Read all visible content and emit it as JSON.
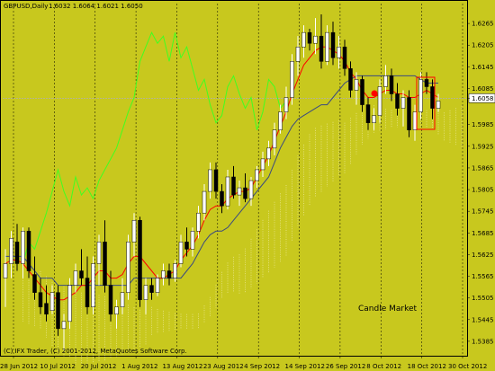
{
  "window": {
    "title": "GBPUSD,Daily",
    "ohlc": "1.6032 1.6064 1.6021 1.6050",
    "copyright": "(C) IFX Trader, (C) 2001-2012, MetaQuotes Software Corp.",
    "watermark": "Candle Market"
  },
  "colors": {
    "background": "#c8c81e",
    "bull_candle": "#ffffff",
    "bear_candle": "#000000",
    "tenkan": "#ff0000",
    "kijun": "#3a4a80",
    "chikou": "#40ff20",
    "cloud_a": "#f5f0b4",
    "cloud_b": "#e8b070",
    "price_line": "#b0b0b0"
  },
  "chart_data": {
    "type": "candlestick",
    "symbol": "GBPUSD",
    "timeframe": "Daily",
    "last_price": 1.6058,
    "ylim": [
      1.535,
      1.632
    ],
    "y_ticks": [
      "1.6265",
      "1.6205",
      "1.6145",
      "1.6085",
      "1.6058",
      "1.5985",
      "1.5925",
      "1.5865",
      "1.5805",
      "1.5745",
      "1.5685",
      "1.5625",
      "1.5565",
      "1.5505",
      "1.5445",
      "1.5385"
    ],
    "x_ticks": [
      "28 Jun 2012",
      "10 Jul 2012",
      "20 Jul 2012",
      "1 Aug 2012",
      "13 Aug 2012",
      "23 Aug 2012",
      "4 Sep 2012",
      "14 Sep 2012",
      "26 Sep 2012",
      "8 Oct 2012",
      "18 Oct 2012",
      "30 Oct 2012"
    ],
    "grid": "vertical dotted separators",
    "candles": [
      {
        "o": 1.556,
        "h": 1.564,
        "l": 1.548,
        "c": 1.56
      },
      {
        "o": 1.56,
        "h": 1.569,
        "l": 1.556,
        "c": 1.567
      },
      {
        "o": 1.566,
        "h": 1.571,
        "l": 1.558,
        "c": 1.56
      },
      {
        "o": 1.56,
        "h": 1.57,
        "l": 1.556,
        "c": 1.569
      },
      {
        "o": 1.569,
        "h": 1.57,
        "l": 1.556,
        "c": 1.558
      },
      {
        "o": 1.557,
        "h": 1.562,
        "l": 1.55,
        "c": 1.552
      },
      {
        "o": 1.552,
        "h": 1.556,
        "l": 1.546,
        "c": 1.548
      },
      {
        "o": 1.549,
        "h": 1.554,
        "l": 1.544,
        "c": 1.546
      },
      {
        "o": 1.547,
        "h": 1.554,
        "l": 1.546,
        "c": 1.552
      },
      {
        "o": 1.552,
        "h": 1.554,
        "l": 1.54,
        "c": 1.542
      },
      {
        "o": 1.542,
        "h": 1.546,
        "l": 1.536,
        "c": 1.544
      },
      {
        "o": 1.544,
        "h": 1.556,
        "l": 1.542,
        "c": 1.554
      },
      {
        "o": 1.554,
        "h": 1.56,
        "l": 1.552,
        "c": 1.558
      },
      {
        "o": 1.558,
        "h": 1.564,
        "l": 1.554,
        "c": 1.556
      },
      {
        "o": 1.556,
        "h": 1.562,
        "l": 1.546,
        "c": 1.548
      },
      {
        "o": 1.548,
        "h": 1.562,
        "l": 1.546,
        "c": 1.56
      },
      {
        "o": 1.56,
        "h": 1.568,
        "l": 1.554,
        "c": 1.566
      },
      {
        "o": 1.566,
        "h": 1.572,
        "l": 1.552,
        "c": 1.554
      },
      {
        "o": 1.554,
        "h": 1.558,
        "l": 1.544,
        "c": 1.546
      },
      {
        "o": 1.546,
        "h": 1.55,
        "l": 1.542,
        "c": 1.548
      },
      {
        "o": 1.548,
        "h": 1.556,
        "l": 1.546,
        "c": 1.552
      },
      {
        "o": 1.552,
        "h": 1.568,
        "l": 1.55,
        "c": 1.566
      },
      {
        "o": 1.566,
        "h": 1.574,
        "l": 1.562,
        "c": 1.572
      },
      {
        "o": 1.572,
        "h": 1.573,
        "l": 1.548,
        "c": 1.55
      },
      {
        "o": 1.55,
        "h": 1.556,
        "l": 1.546,
        "c": 1.554
      },
      {
        "o": 1.554,
        "h": 1.556,
        "l": 1.55,
        "c": 1.552
      },
      {
        "o": 1.552,
        "h": 1.557,
        "l": 1.551,
        "c": 1.556
      },
      {
        "o": 1.556,
        "h": 1.56,
        "l": 1.554,
        "c": 1.558
      },
      {
        "o": 1.558,
        "h": 1.56,
        "l": 1.554,
        "c": 1.556
      },
      {
        "o": 1.556,
        "h": 1.561,
        "l": 1.555,
        "c": 1.56
      },
      {
        "o": 1.56,
        "h": 1.568,
        "l": 1.559,
        "c": 1.566
      },
      {
        "o": 1.566,
        "h": 1.57,
        "l": 1.562,
        "c": 1.564
      },
      {
        "o": 1.564,
        "h": 1.57,
        "l": 1.562,
        "c": 1.569
      },
      {
        "o": 1.569,
        "h": 1.576,
        "l": 1.567,
        "c": 1.574
      },
      {
        "o": 1.574,
        "h": 1.582,
        "l": 1.572,
        "c": 1.58
      },
      {
        "o": 1.58,
        "h": 1.588,
        "l": 1.578,
        "c": 1.586
      },
      {
        "o": 1.586,
        "h": 1.588,
        "l": 1.578,
        "c": 1.58
      },
      {
        "o": 1.58,
        "h": 1.582,
        "l": 1.574,
        "c": 1.576
      },
      {
        "o": 1.576,
        "h": 1.586,
        "l": 1.575,
        "c": 1.584
      },
      {
        "o": 1.584,
        "h": 1.587,
        "l": 1.578,
        "c": 1.579
      },
      {
        "o": 1.579,
        "h": 1.583,
        "l": 1.576,
        "c": 1.581
      },
      {
        "o": 1.581,
        "h": 1.585,
        "l": 1.577,
        "c": 1.578
      },
      {
        "o": 1.578,
        "h": 1.584,
        "l": 1.576,
        "c": 1.583
      },
      {
        "o": 1.583,
        "h": 1.587,
        "l": 1.581,
        "c": 1.586
      },
      {
        "o": 1.586,
        "h": 1.591,
        "l": 1.584,
        "c": 1.589
      },
      {
        "o": 1.589,
        "h": 1.594,
        "l": 1.587,
        "c": 1.592
      },
      {
        "o": 1.592,
        "h": 1.599,
        "l": 1.59,
        "c": 1.597
      },
      {
        "o": 1.597,
        "h": 1.604,
        "l": 1.596,
        "c": 1.602
      },
      {
        "o": 1.602,
        "h": 1.609,
        "l": 1.6,
        "c": 1.606
      },
      {
        "o": 1.606,
        "h": 1.618,
        "l": 1.604,
        "c": 1.616
      },
      {
        "o": 1.616,
        "h": 1.623,
        "l": 1.612,
        "c": 1.62
      },
      {
        "o": 1.62,
        "h": 1.626,
        "l": 1.617,
        "c": 1.624
      },
      {
        "o": 1.624,
        "h": 1.625,
        "l": 1.619,
        "c": 1.621
      },
      {
        "o": 1.621,
        "h": 1.628,
        "l": 1.618,
        "c": 1.623
      },
      {
        "o": 1.623,
        "h": 1.629,
        "l": 1.614,
        "c": 1.616
      },
      {
        "o": 1.616,
        "h": 1.626,
        "l": 1.615,
        "c": 1.624
      },
      {
        "o": 1.624,
        "h": 1.627,
        "l": 1.615,
        "c": 1.617
      },
      {
        "o": 1.617,
        "h": 1.623,
        "l": 1.614,
        "c": 1.62
      },
      {
        "o": 1.62,
        "h": 1.622,
        "l": 1.612,
        "c": 1.614
      },
      {
        "o": 1.614,
        "h": 1.616,
        "l": 1.606,
        "c": 1.608
      },
      {
        "o": 1.608,
        "h": 1.613,
        "l": 1.604,
        "c": 1.611
      },
      {
        "o": 1.611,
        "h": 1.612,
        "l": 1.602,
        "c": 1.604
      },
      {
        "o": 1.604,
        "h": 1.606,
        "l": 1.597,
        "c": 1.599
      },
      {
        "o": 1.599,
        "h": 1.603,
        "l": 1.597,
        "c": 1.601
      },
      {
        "o": 1.601,
        "h": 1.611,
        "l": 1.599,
        "c": 1.609
      },
      {
        "o": 1.609,
        "h": 1.615,
        "l": 1.607,
        "c": 1.612
      },
      {
        "o": 1.612,
        "h": 1.614,
        "l": 1.605,
        "c": 1.607
      },
      {
        "o": 1.607,
        "h": 1.61,
        "l": 1.601,
        "c": 1.603
      },
      {
        "o": 1.603,
        "h": 1.608,
        "l": 1.598,
        "c": 1.606
      },
      {
        "o": 1.606,
        "h": 1.608,
        "l": 1.595,
        "c": 1.597
      },
      {
        "o": 1.597,
        "h": 1.604,
        "l": 1.594,
        "c": 1.602
      },
      {
        "o": 1.602,
        "h": 1.613,
        "l": 1.6,
        "c": 1.611
      },
      {
        "o": 1.611,
        "h": 1.613,
        "l": 1.607,
        "c": 1.609
      },
      {
        "o": 1.609,
        "h": 1.611,
        "l": 1.6,
        "c": 1.603
      },
      {
        "o": 1.603,
        "h": 1.607,
        "l": 1.602,
        "c": 1.605
      }
    ],
    "tenkan": [
      1.56,
      1.561,
      1.561,
      1.56,
      1.558,
      1.556,
      1.554,
      1.552,
      1.551,
      1.55,
      1.55,
      1.551,
      1.552,
      1.554,
      1.554,
      1.556,
      1.558,
      1.558,
      1.556,
      1.556,
      1.557,
      1.56,
      1.562,
      1.562,
      1.56,
      1.558,
      1.556,
      1.556,
      1.557,
      1.558,
      1.561,
      1.563,
      1.565,
      1.568,
      1.572,
      1.575,
      1.576,
      1.576,
      1.578,
      1.579,
      1.58,
      1.58,
      1.581,
      1.584,
      1.587,
      1.59,
      1.594,
      1.598,
      1.602,
      1.607,
      1.611,
      1.615,
      1.617,
      1.619,
      1.62,
      1.62,
      1.619,
      1.618,
      1.616,
      1.613,
      1.611,
      1.608,
      1.606,
      1.606,
      1.607,
      1.608,
      1.608,
      1.607,
      1.607,
      1.606,
      1.606,
      1.607,
      1.608,
      1.607,
      1.606
    ],
    "kijun": [
      1.562,
      1.562,
      1.562,
      1.562,
      1.56,
      1.558,
      1.556,
      1.556,
      1.556,
      1.554,
      1.554,
      1.554,
      1.554,
      1.554,
      1.554,
      1.554,
      1.554,
      1.554,
      1.554,
      1.554,
      1.554,
      1.554,
      1.556,
      1.556,
      1.556,
      1.556,
      1.556,
      1.556,
      1.556,
      1.556,
      1.556,
      1.558,
      1.56,
      1.563,
      1.566,
      1.568,
      1.569,
      1.569,
      1.57,
      1.572,
      1.574,
      1.576,
      1.578,
      1.58,
      1.582,
      1.584,
      1.588,
      1.592,
      1.595,
      1.598,
      1.6,
      1.601,
      1.602,
      1.603,
      1.604,
      1.604,
      1.606,
      1.608,
      1.61,
      1.611,
      1.612,
      1.612,
      1.612,
      1.612,
      1.612,
      1.612,
      1.612,
      1.612,
      1.612,
      1.612,
      1.612,
      1.611,
      1.61,
      1.61,
      1.61
    ],
    "chikou_offset": -26,
    "cloud": {
      "span_a_color": "#f5f0b4",
      "span_b_color": "#e8b070"
    }
  }
}
